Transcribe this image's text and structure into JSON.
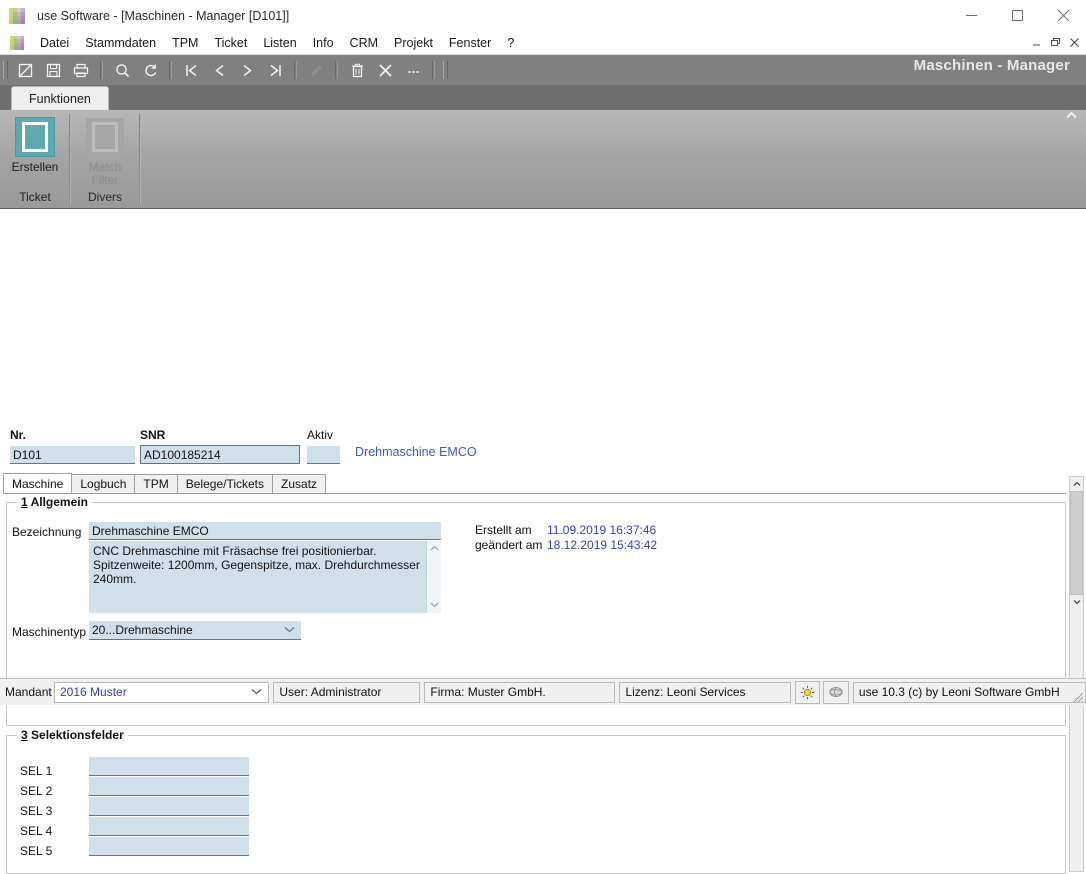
{
  "window": {
    "title": "use Software - [Maschinen - Manager [D101]]",
    "app_icon": "grid-logo-icon",
    "minimize": "minimize-icon",
    "maximize": "maximize-icon",
    "close": "close-icon"
  },
  "menu": {
    "icon": "grid-logo-icon",
    "items": [
      "Datei",
      "Stammdaten",
      "TPM",
      "Ticket",
      "Listen",
      "Info",
      "CRM",
      "Projekt",
      "Fenster",
      "?"
    ],
    "mdi": {
      "minimize": "mdi-minimize-icon",
      "restore": "mdi-restore-icon",
      "close": "mdi-close-icon"
    }
  },
  "toolbar": {
    "buttons": [
      {
        "name": "new-record-icon",
        "enabled": true
      },
      {
        "name": "save-icon",
        "enabled": true
      },
      {
        "name": "print-icon",
        "enabled": true
      },
      {
        "name": "search-icon",
        "enabled": true
      },
      {
        "name": "refresh-icon",
        "enabled": true
      },
      {
        "name": "first-record-icon",
        "enabled": true
      },
      {
        "name": "previous-record-icon",
        "enabled": true
      },
      {
        "name": "next-record-icon",
        "enabled": true
      },
      {
        "name": "last-record-icon",
        "enabled": true
      },
      {
        "name": "edit-icon",
        "enabled": false
      },
      {
        "name": "delete-icon",
        "enabled": true
      },
      {
        "name": "cancel-icon",
        "enabled": true
      },
      {
        "name": "more-icon",
        "enabled": true
      }
    ],
    "mdi_title": "Maschinen - Manager",
    "collapse": "▲"
  },
  "ribbon": {
    "tab": "Funktionen",
    "groups": [
      {
        "button_label": "Erstellen",
        "group_label": "Ticket",
        "icon": "create-ticket-icon",
        "enabled": true
      },
      {
        "button_label": "Match\nFilter",
        "group_label": "Divers",
        "icon": "match-filter-icon",
        "enabled": false
      }
    ]
  },
  "header_fields": {
    "nr_label": "Nr.",
    "nr_value": "D101",
    "snr_label": "SNR",
    "snr_value": "AD100185214",
    "aktiv_label": "Aktiv",
    "aktiv_value": "",
    "machine_title": "Drehmaschine EMCO"
  },
  "tabs": [
    {
      "label": "Maschine",
      "active": true
    },
    {
      "label": "Logbuch",
      "active": false
    },
    {
      "label": "TPM",
      "active": false
    },
    {
      "label": "Belege/Tickets",
      "active": false
    },
    {
      "label": "Zusatz",
      "active": false
    }
  ],
  "allgemein": {
    "number": "1",
    "title": "Allgemein",
    "bezeichnung_label": "Bezeichnung",
    "bezeichnung_value": "Drehmaschine EMCO",
    "beschreibung_value": "CNC Drehmaschine mit Fräsachse frei positionierbar. Spitzenweite: 1200mm, Gegenspitze, max. Drehdurchmesser 240mm.",
    "maschinentyp_label": "Maschinentyp",
    "maschinentyp_value": "20...Drehmaschine",
    "maschinentyp_options": [
      "20...Drehmaschine"
    ],
    "erstellt_label": "Erstellt am",
    "erstellt_value": "11.09.2019 16:37:46",
    "geaendert_label": "geändert am",
    "geaendert_value": "18.12.2019 15:43:42"
  },
  "selektionsfelder": {
    "number": "3",
    "title": "Selektionsfelder",
    "rows": [
      {
        "label": "SEL 1",
        "value": ""
      },
      {
        "label": "SEL 2",
        "value": ""
      },
      {
        "label": "SEL 3",
        "value": ""
      },
      {
        "label": "SEL 4",
        "value": ""
      },
      {
        "label": "SEL 5",
        "value": ""
      }
    ]
  },
  "statusbar": {
    "mandant_label": "Mandant",
    "mandant_value": "2016 Muster",
    "mandant_options": [
      "2016 Muster"
    ],
    "user": "User: Administrator",
    "firma": "Firma: Muster GmbH.",
    "lizenz": "Lizenz: Leoni Services",
    "icon_sun": "sun-icon",
    "icon_globe": "globe-icon",
    "version": "use 10.3 (c) by Leoni Software GmbH"
  },
  "colors": {
    "field_bg": "#cfe0ea",
    "accent_teal": "#5fa8b0",
    "link_blue": "#3b5bbf",
    "toolbar_gray": "#808080",
    "ribbon_gray": "#a2a2a2"
  }
}
